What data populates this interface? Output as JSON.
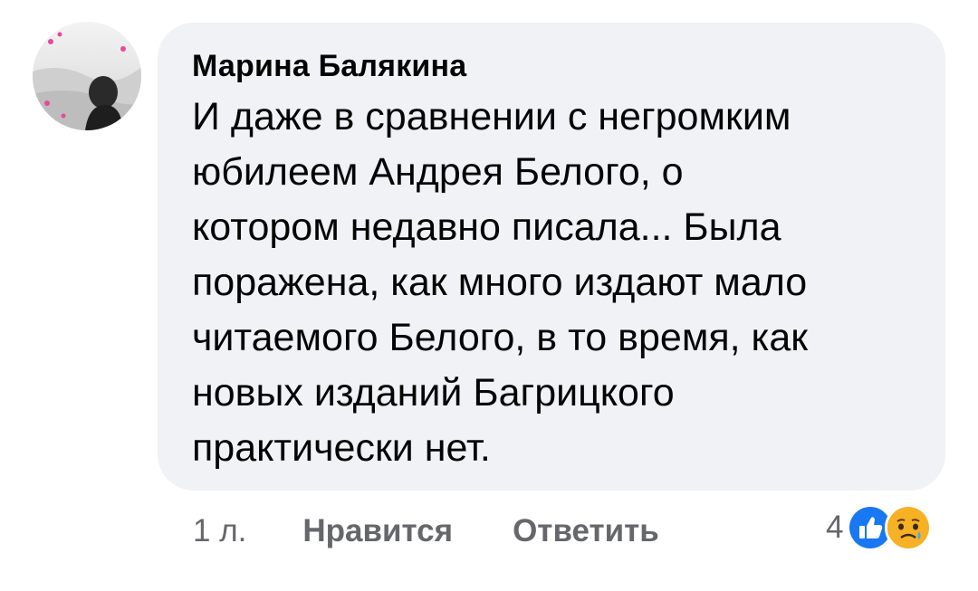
{
  "comment": {
    "author": "Марина Балякина",
    "text": "И даже в сравнении с негромким\nюбилеем Андрея Белого, о\nкотором недавно писала... Была\nпоражена, как много издают мало\nчитаемого Белого, в то время, как\nновых изданий Багрицкого\nпрактически нет.",
    "bubble_color": "#f0f2f5"
  },
  "actions": {
    "time": "1 л.",
    "like_label": "Нравится",
    "reply_label": "Ответить"
  },
  "reactions": {
    "count": "4",
    "icons": [
      "like-icon",
      "sad-icon"
    ],
    "like_color": "#1877f2",
    "sad_color": "#f7b125"
  }
}
